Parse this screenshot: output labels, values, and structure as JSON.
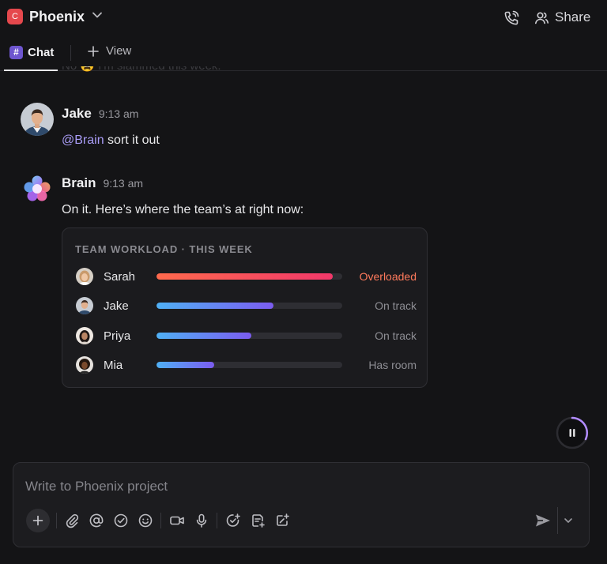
{
  "header": {
    "project_initial": "C",
    "project_name": "Phoenix",
    "share_label": "Share"
  },
  "tabs": {
    "chat_label": "Chat",
    "chat_icon": "#",
    "view_label": "View"
  },
  "faded_message": "No 😩 I'm slammed this week.",
  "messages": [
    {
      "author": "Jake",
      "time": "9:13 am",
      "mention": "@Brain",
      "text": " sort it out"
    },
    {
      "author": "Brain",
      "time": "9:13 am",
      "text": "On it. Here’s where the team’s at right now:"
    }
  ],
  "workload_card": {
    "title": "TEAM WORKLOAD · THIS WEEK",
    "members": [
      {
        "name": "Sarah",
        "load": 0.95,
        "status": "Overloaded",
        "status_color": "#ff7a5c",
        "bar_from": "#ff6a4d",
        "bar_to": "#f2386a"
      },
      {
        "name": "Jake",
        "load": 0.63,
        "status": "On track",
        "status_color": "#8e8e94",
        "bar_from": "#4fb0f5",
        "bar_to": "#7b5cf0"
      },
      {
        "name": "Priya",
        "load": 0.51,
        "status": "On track",
        "status_color": "#8e8e94",
        "bar_from": "#4fb0f5",
        "bar_to": "#7b5cf0"
      },
      {
        "name": "Mia",
        "load": 0.31,
        "status": "Has room",
        "status_color": "#8e8e94",
        "bar_from": "#4fb0f5",
        "bar_to": "#7b5cf0"
      }
    ]
  },
  "composer": {
    "placeholder": "Write to Phoenix project"
  },
  "colors": {
    "accent": "#6e56cf",
    "mention": "#a99cf6",
    "project_badge": "#e5484d"
  },
  "icons": [
    "chevron-down-icon",
    "phone-call-icon",
    "users-icon",
    "plus-icon",
    "paperclip-icon",
    "at-sign-icon",
    "check-circle-icon",
    "smile-icon",
    "video-icon",
    "microphone-icon",
    "task-add-icon",
    "doc-add-icon",
    "wand-add-icon",
    "send-icon",
    "pause-icon"
  ]
}
